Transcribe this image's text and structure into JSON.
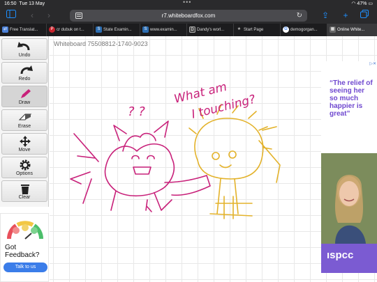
{
  "status_bar": {
    "time": "16:50",
    "date": "Tue 13 May",
    "battery": "47%"
  },
  "browser": {
    "url": "r7.whiteboardfox.com",
    "tabs": [
      {
        "label": "Free Translat...",
        "icon": "translate-icon",
        "color": "#4a7fd6"
      },
      {
        "label": "cr dubuk on t...",
        "icon": "pinterest-icon",
        "color": "#c8232c"
      },
      {
        "label": "State Examin...",
        "icon": "state-exam-icon",
        "color": "#2b6cb0"
      },
      {
        "label": "www.examin...",
        "icon": "exam-icon",
        "color": "#2b6cb0"
      },
      {
        "label": "Dandy's worl...",
        "icon": "dandy-icon",
        "color": "#444444"
      },
      {
        "label": "Start Page",
        "icon": "star-icon",
        "color": "#888888"
      },
      {
        "label": "demogorgan...",
        "icon": "google-icon",
        "color": "#ffffff"
      },
      {
        "label": "Online White...",
        "icon": "whiteboard-icon",
        "color": "#666666"
      }
    ]
  },
  "tools": [
    {
      "label": "Undo",
      "icon": "undo-icon"
    },
    {
      "label": "Redo",
      "icon": "redo-icon"
    },
    {
      "label": "Draw",
      "icon": "pen-icon"
    },
    {
      "label": "Erase",
      "icon": "eraser-icon"
    },
    {
      "label": "Move",
      "icon": "move-icon"
    },
    {
      "label": "Options",
      "icon": "gear-icon"
    },
    {
      "label": "Clear",
      "icon": "trash-icon"
    }
  ],
  "feedback": {
    "title": "Got Feedback?",
    "button": "Talk to us"
  },
  "whiteboard": {
    "id_label": "Whiteboard 75508812-1740-9023",
    "handwriting_1": "What am",
    "handwriting_2": "I touching?",
    "question_marks": "? ?",
    "colors": {
      "pink": "#c8217a",
      "yellow": "#e3b22a"
    }
  },
  "ad": {
    "text": "“The relief of seeing her so much happier is great”",
    "brand": "ıspcc",
    "accent": "#7b5bd2"
  }
}
